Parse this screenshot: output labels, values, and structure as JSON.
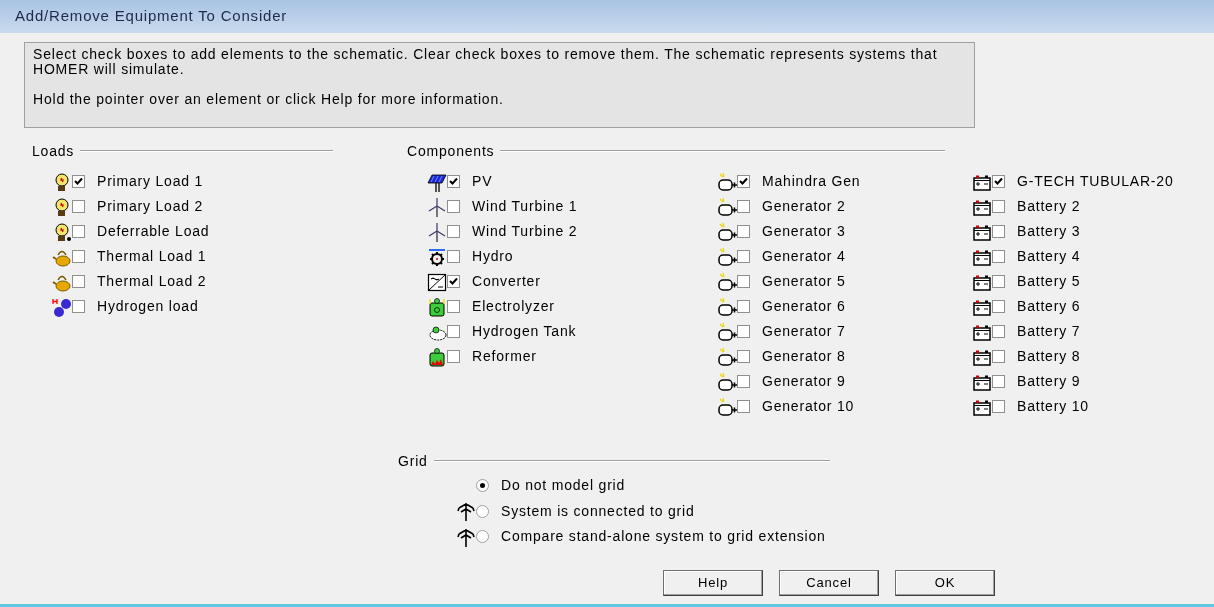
{
  "window": {
    "title": "Add/Remove Equipment To Consider"
  },
  "info": [
    "Select check boxes to add elements to the schematic. Clear check boxes to remove them. The schematic represents systems that HOMER will simulate.",
    "Hold the pointer over an element or click Help for more information."
  ],
  "loads": {
    "label": "Loads",
    "items": [
      {
        "kind": "electric",
        "label": "Primary Load 1",
        "checked": true
      },
      {
        "kind": "electric",
        "label": "Primary Load 2",
        "checked": false
      },
      {
        "kind": "deferrable",
        "label": "Deferrable Load",
        "checked": false
      },
      {
        "kind": "thermal",
        "label": "Thermal Load 1",
        "checked": false
      },
      {
        "kind": "thermal",
        "label": "Thermal Load 2",
        "checked": false
      },
      {
        "kind": "hydrogen",
        "label": "Hydrogen load",
        "checked": false
      }
    ]
  },
  "components": {
    "label": "Components",
    "items": [
      {
        "kind": "pv",
        "label": "PV",
        "checked": true
      },
      {
        "kind": "wind",
        "label": "Wind Turbine 1",
        "checked": false
      },
      {
        "kind": "wind",
        "label": "Wind Turbine 2",
        "checked": false
      },
      {
        "kind": "hydro",
        "label": "Hydro",
        "checked": false
      },
      {
        "kind": "converter",
        "label": "Converter",
        "checked": true
      },
      {
        "kind": "electrolyzer",
        "label": "Electrolyzer",
        "checked": false
      },
      {
        "kind": "tank",
        "label": "Hydrogen Tank",
        "checked": false
      },
      {
        "kind": "reformer",
        "label": "Reformer",
        "checked": false
      }
    ],
    "generators": [
      {
        "kind": "generator",
        "label": "Mahindra Gen",
        "checked": true
      },
      {
        "kind": "generator",
        "label": "Generator 2",
        "checked": false
      },
      {
        "kind": "generator",
        "label": "Generator 3",
        "checked": false
      },
      {
        "kind": "generator",
        "label": "Generator 4",
        "checked": false
      },
      {
        "kind": "generator",
        "label": "Generator 5",
        "checked": false
      },
      {
        "kind": "generator",
        "label": "Generator 6",
        "checked": false
      },
      {
        "kind": "generator",
        "label": "Generator 7",
        "checked": false
      },
      {
        "kind": "generator",
        "label": "Generator 8",
        "checked": false
      },
      {
        "kind": "generator",
        "label": "Generator 9",
        "checked": false
      },
      {
        "kind": "generator",
        "label": "Generator 10",
        "checked": false
      }
    ],
    "batteries": [
      {
        "kind": "battery",
        "label": "G-TECH TUBULAR-20",
        "checked": true
      },
      {
        "kind": "battery",
        "label": "Battery 2",
        "checked": false
      },
      {
        "kind": "battery",
        "label": "Battery 3",
        "checked": false
      },
      {
        "kind": "battery",
        "label": "Battery 4",
        "checked": false
      },
      {
        "kind": "battery",
        "label": "Battery 5",
        "checked": false
      },
      {
        "kind": "battery",
        "label": "Battery 6",
        "checked": false
      },
      {
        "kind": "battery",
        "label": "Battery 7",
        "checked": false
      },
      {
        "kind": "battery",
        "label": "Battery 8",
        "checked": false
      },
      {
        "kind": "battery",
        "label": "Battery 9",
        "checked": false
      },
      {
        "kind": "battery",
        "label": "Battery 10",
        "checked": false
      }
    ]
  },
  "grid": {
    "label": "Grid",
    "options": [
      {
        "kind": "plain",
        "label": "Do not model grid",
        "selected": true
      },
      {
        "kind": "tower",
        "label": "System is connected to grid",
        "selected": false
      },
      {
        "kind": "tower",
        "label": "Compare stand-alone system to grid extension",
        "selected": false
      }
    ]
  },
  "buttons": [
    "Help",
    "Cancel",
    "OK"
  ]
}
